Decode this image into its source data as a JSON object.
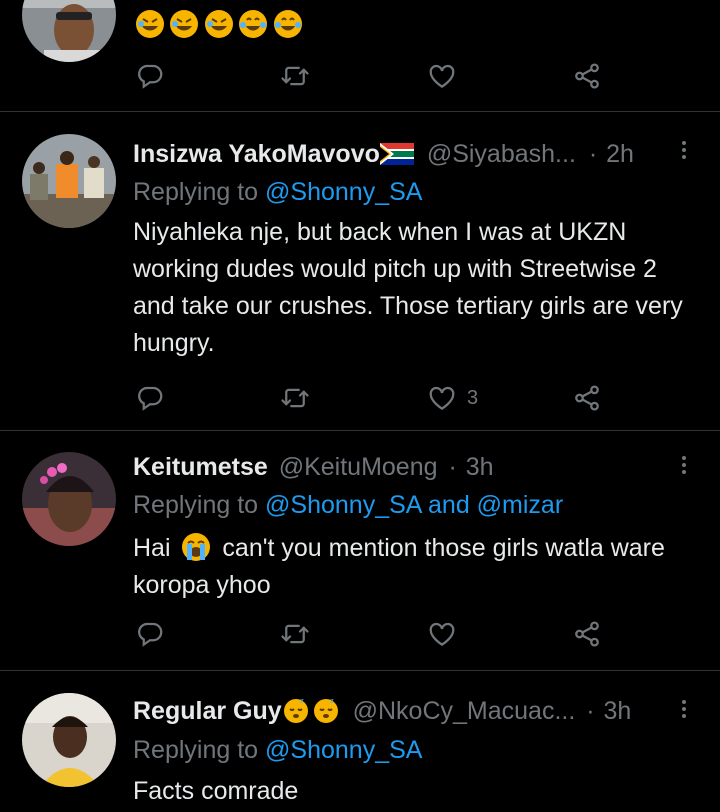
{
  "tweet0": {
    "emojis": [
      "rolling-on-floor-laughing",
      "rolling-on-floor-laughing",
      "rolling-on-floor-laughing",
      "face-with-tears-of-joy",
      "face-with-tears-of-joy"
    ],
    "like_count": ""
  },
  "tweet1": {
    "name": "Insizwa YakoMavovo",
    "handle": "@Siyabash...",
    "dot": "·",
    "time": "2h",
    "replying_prefix": "Replying to",
    "replying_to": "@Shonny_SA",
    "text": "Niyahleka nje, but back when I was at UKZN working dudes would pitch up with Streetwise 2 and take our crushes. Those tertiary girls are very hungry.",
    "like_count": "3"
  },
  "tweet2": {
    "name": "Keitumetse",
    "handle": "@KeituMoeng",
    "dot": "·",
    "time": "3h",
    "replying_prefix": "Replying to",
    "replying_to": "@Shonny_SA and @mizar",
    "text_before": "Hai",
    "text_after": "can't you mention those girls watla ware koropa yhoo"
  },
  "tweet3": {
    "name": "Regular Guy",
    "handle": "@NkoCy_Macuac...",
    "dot": "·",
    "time": "3h",
    "replying_prefix": "Replying to",
    "replying_to": "@Shonny_SA",
    "text": "Facts comrade"
  },
  "icons": [
    "reply-icon",
    "retweet-icon",
    "like-icon",
    "share-icon",
    "more-icon"
  ],
  "colors": {
    "background": "#000000",
    "text": "#e7e9ea",
    "muted": "#71767b",
    "link": "#1d9bf0",
    "divider": "#2f3336"
  }
}
